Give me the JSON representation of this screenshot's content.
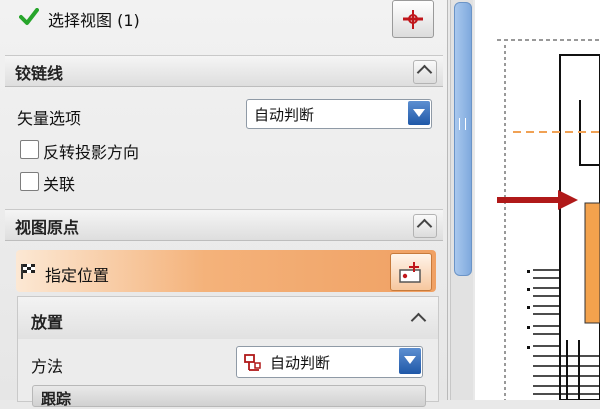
{
  "select_view": {
    "label": "选择视图 (1)"
  },
  "hinge_line": {
    "header": "铰链线",
    "vector_option_label": "矢量选项",
    "vector_option_value": "自动判断",
    "reverse_projection_label": "反转投影方向",
    "associative_label": "关联"
  },
  "view_origin": {
    "header": "视图原点",
    "specify_location_label": "指定位置",
    "placement": {
      "header": "放置",
      "method_label": "方法",
      "method_value": "自动判断",
      "next_header": "跟踪"
    }
  },
  "colors": {
    "accent_orange": "#f1a15f",
    "combo_arrow_blue": "#2f6cc0",
    "check_green": "#27a52b",
    "red_arrow": "#b01919"
  },
  "icons": [
    "check-icon",
    "select-view-icon",
    "chevron-up-icon",
    "flag-icon",
    "point-location-icon",
    "placement-method-icon",
    "dropdown-arrow-icon"
  ]
}
